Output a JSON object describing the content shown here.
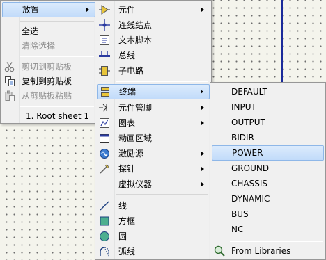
{
  "menu1": {
    "place": "放置",
    "select_all": "全选",
    "clear_selection": "清除选择",
    "cut": "剪切到剪贴板",
    "copy": "复制到剪贴板",
    "paste": "从剪贴板粘贴",
    "root_sheet_num": "1",
    "root_sheet_rest": ". Root sheet 1"
  },
  "menu2": {
    "component": "元件",
    "junction": "连线结点",
    "text_script": "文本脚本",
    "bus": "总线",
    "subcircuit": "子电路",
    "terminal": "终端",
    "component_pin": "元件管脚",
    "graph": "图表",
    "animation_area": "动画区域",
    "generator": "激励源",
    "probe": "探针",
    "virtual_instrument": "虚拟仪器",
    "line": "线",
    "box": "方框",
    "circle": "圆",
    "arc": "弧线"
  },
  "menu3": {
    "items": [
      "DEFAULT",
      "INPUT",
      "OUTPUT",
      "BIDIR",
      "POWER",
      "GROUND",
      "CHASSIS",
      "DYNAMIC",
      "BUS",
      "NC"
    ],
    "from_libraries": "From Libraries"
  },
  "colors": {
    "highlight": "#c9e0f7",
    "wire": "#1a2a9a",
    "disabled_text": "#8e8e8e"
  }
}
